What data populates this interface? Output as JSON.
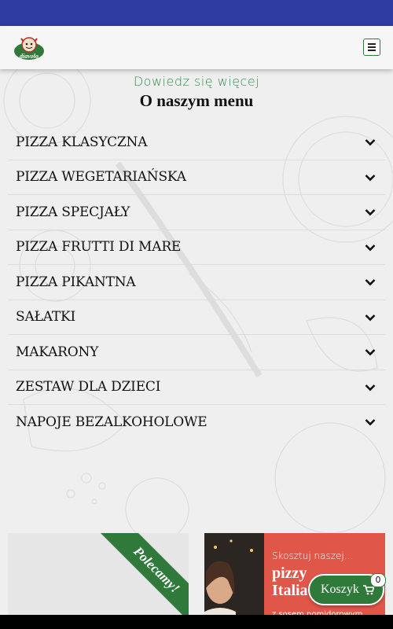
{
  "header": {
    "logo_text": "diavolo",
    "menu_icon": "hamburger-icon"
  },
  "section": {
    "subtitle": "Dowiedz się więcej",
    "title": "O naszym menu"
  },
  "menu": {
    "items": [
      {
        "label": "PIZZA KLASYCZNA"
      },
      {
        "label": "PIZZA WEGETARIAŃSKA"
      },
      {
        "label": "PIZZA SPECJAŁY"
      },
      {
        "label": "PIZZA FRUTTI DI MARE"
      },
      {
        "label": "PIZZA PIKANTNA"
      },
      {
        "label": "SAŁATKI"
      },
      {
        "label": "MAKARONY"
      },
      {
        "label": "ZESTAW DLA DZIECI"
      },
      {
        "label": "NAPOJE BEZALKOHOLOWE"
      }
    ],
    "expand_icon": "chevron-down-icon"
  },
  "cards": {
    "recommended_label": "Polecamy!",
    "promo_small": "Skosztuj naszej...",
    "promo_big_line1": "pizzy",
    "promo_big_line2": "Italia",
    "promo_foot": "z sosem pomidorowym"
  },
  "cart": {
    "label": "Koszyk",
    "count": "0",
    "icon": "cart-icon"
  },
  "colors": {
    "status_bar": "#2e3d9f",
    "brand_green": "#2f7a3a",
    "promo_red": "#e0574a"
  }
}
